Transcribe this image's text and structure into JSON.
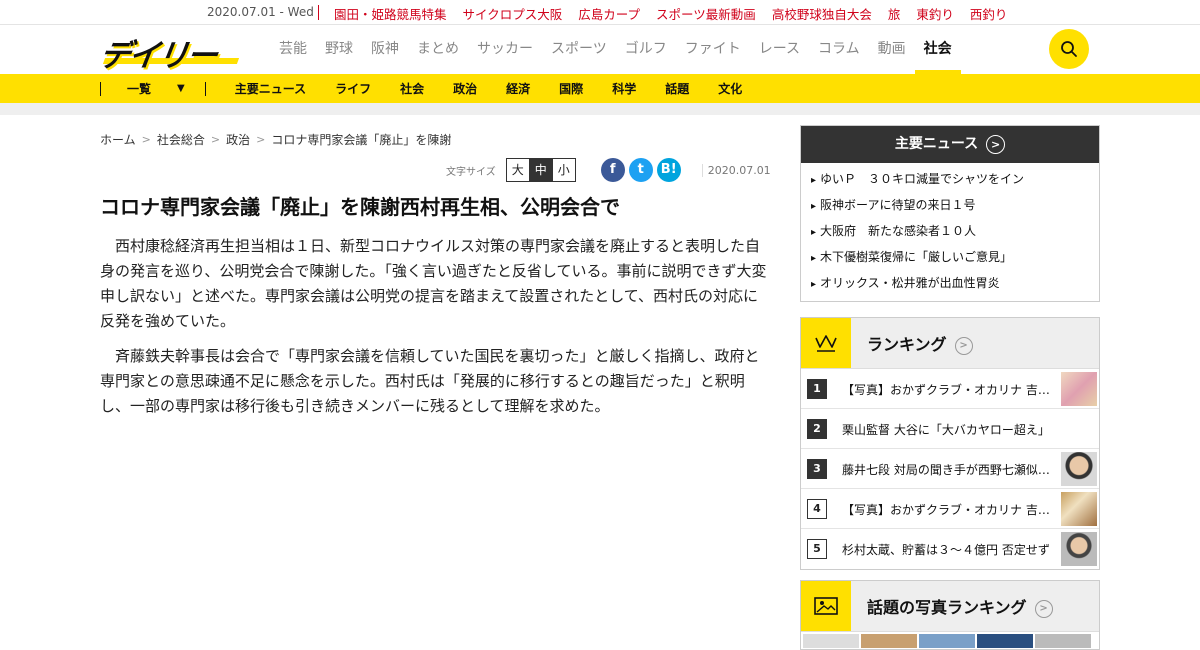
{
  "topbar": {
    "date": "2020.07.01 - Wed",
    "links": [
      "園田・姫路競馬特集",
      "サイクロプス大阪",
      "広島カープ",
      "スポーツ最新動画",
      "高校野球独自大会",
      "旅",
      "東釣り",
      "西釣り"
    ]
  },
  "header": {
    "logo_text": "デイリー",
    "nav": [
      {
        "label": "芸能"
      },
      {
        "label": "野球"
      },
      {
        "label": "阪神"
      },
      {
        "label": "まとめ"
      },
      {
        "label": "サッカー"
      },
      {
        "label": "スポーツ"
      },
      {
        "label": "ゴルフ"
      },
      {
        "label": "ファイト"
      },
      {
        "label": "レース"
      },
      {
        "label": "コラム"
      },
      {
        "label": "動画"
      },
      {
        "label": "社会"
      }
    ],
    "active": "社会",
    "search_icon": "search-icon"
  },
  "subnav": {
    "list_label": "一覧",
    "items": [
      "主要ニュース",
      "ライフ",
      "社会",
      "政治",
      "経済",
      "国際",
      "科学",
      "話題",
      "文化"
    ]
  },
  "breadcrumb": [
    "ホーム",
    "社会総合",
    "政治",
    "コロナ専門家会議「廃止」を陳謝"
  ],
  "tools": {
    "font_size_label": "文字サイズ",
    "sizes": [
      "大",
      "中",
      "小"
    ],
    "selected_size": "中",
    "date": "2020.07.01",
    "social": {
      "facebook": "f",
      "twitter": "t",
      "hatena": "B!"
    }
  },
  "article": {
    "headline": "コロナ専門家会議「廃止」を陳謝西村再生相、公明会合で",
    "paragraphs": [
      "西村康稔経済再生担当相は１日、新型コロナウイルス対策の専門家会議を廃止すると表明した自身の発言を巡り、公明党会合で陳謝した。「強く言い過ぎたと反省している。事前に説明できず大変申し訳ない」と述べた。専門家会議は公明党の提言を踏まえて設置されたとして、西村氏の対応に反発を強めていた。",
      "斉藤鉄夫幹事長は会合で「専門家会議を信頼していた国民を裏切った」と厳しく指摘し、政府と専門家との意思疎通不足に懸念を示した。西村氏は「発展的に移行するとの趣旨だった」と釈明し、一部の専門家は移行後も引き続きメンバーに残るとして理解を求めた。"
    ]
  },
  "sidebar": {
    "top_news": {
      "title": "主要ニュース",
      "items": [
        "ゆいＰ　３０キロ減量でシャツをイン",
        "阪神ボーアに待望の来日１号",
        "大阪府　新たな感染者１０人",
        "木下優樹菜復帰に「厳しいご意見」",
        "オリックス・松井雅が出血性胃炎"
      ]
    },
    "ranking": {
      "title": "ランキング",
      "items": [
        {
          "rank": "1",
          "title": "【写真】おかずクラブ・オカリナ 吉…",
          "thumb": true,
          "color": "#e6c7a5"
        },
        {
          "rank": "2",
          "title": "栗山監督 大谷に「大バカヤロー超え」",
          "thumb": false
        },
        {
          "rank": "3",
          "title": "藤井七段 対局の聞き手が西野七瀬似…",
          "thumb": true,
          "color": "#cfcfcf"
        },
        {
          "rank": "4",
          "title": "【写真】おかずクラブ・オカリナ 吉…",
          "thumb": true,
          "color": "#d4b070"
        },
        {
          "rank": "5",
          "title": "杉村太蔵、貯蓄は３～４億円 否定せず",
          "thumb": true,
          "color": "#b8b8b8"
        }
      ]
    },
    "photo_ranking": {
      "title": "話題の写真ランキング"
    }
  },
  "colors": {
    "accent": "#ffe000",
    "link_red": "#d0021b",
    "dark": "#333333"
  }
}
